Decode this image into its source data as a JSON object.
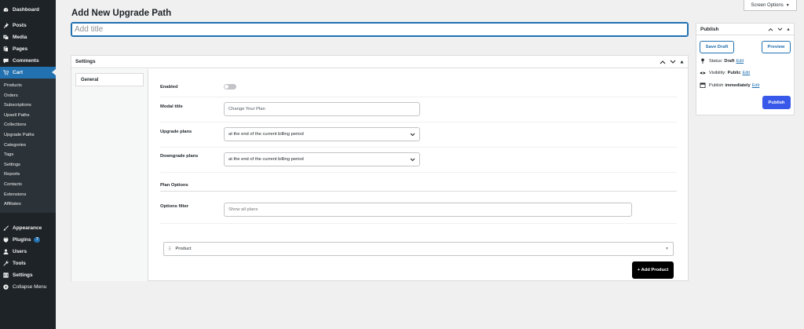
{
  "sidebar": {
    "top_items": [
      {
        "label": "Dashboard",
        "icon": "dashboard-icon"
      },
      {
        "label": "Posts",
        "icon": "pin-icon"
      },
      {
        "label": "Media",
        "icon": "media-icon"
      },
      {
        "label": "Pages",
        "icon": "pages-icon"
      },
      {
        "label": "Comments",
        "icon": "comment-icon"
      },
      {
        "label": "Cart",
        "icon": "cart-icon"
      }
    ],
    "cart_submenu": [
      "Products",
      "Orders",
      "Subscriptions",
      "Upsell Paths",
      "Collections",
      "Upgrade Paths",
      "Categories",
      "Tags",
      "Settings",
      "Reports",
      "Contacts",
      "Extensions",
      "Affiliates"
    ],
    "bottom_items": [
      {
        "label": "Appearance",
        "icon": "brush-icon"
      },
      {
        "label": "Plugins",
        "icon": "plugin-icon",
        "badge": "7"
      },
      {
        "label": "Users",
        "icon": "user-icon"
      },
      {
        "label": "Tools",
        "icon": "wrench-icon"
      },
      {
        "label": "Settings",
        "icon": "settings-icon"
      },
      {
        "label": "Collapse Menu",
        "icon": "collapse-icon"
      }
    ]
  },
  "header": {
    "screen_options": "Screen Options",
    "page_title": "Add New Upgrade Path",
    "title_placeholder": "Add title"
  },
  "settings": {
    "title": "Settings",
    "tab_general": "General",
    "enabled_label": "Enabled",
    "enabled": false,
    "modal_title_label": "Modal title",
    "modal_title_placeholder": "Change Your Plan",
    "upgrade_label": "Upgrade plans",
    "upgrade_value": "at the end of the current billing period",
    "downgrade_label": "Downgrade plans",
    "downgrade_value": "at the end of the current billing period",
    "plan_options_heading": "Plan Options",
    "options_filter_label": "Options filter",
    "options_filter_placeholder": "Show all plans",
    "product_label": "Product",
    "add_product_label": "+ Add Product"
  },
  "publish": {
    "title": "Publish",
    "save_draft": "Save Draft",
    "preview": "Preview",
    "status_label": "Status:",
    "status_value": "Draft",
    "visibility_label": "Visibility:",
    "visibility_value": "Public",
    "publish_label": "Publish",
    "publish_value": "immediately",
    "edit_link": "Edit",
    "publish_button": "Publish"
  },
  "colors": {
    "sidebar_bg": "#1d2327",
    "accent": "#2271b1",
    "publish_button": "#3858e9",
    "add_product_button": "#000000"
  }
}
